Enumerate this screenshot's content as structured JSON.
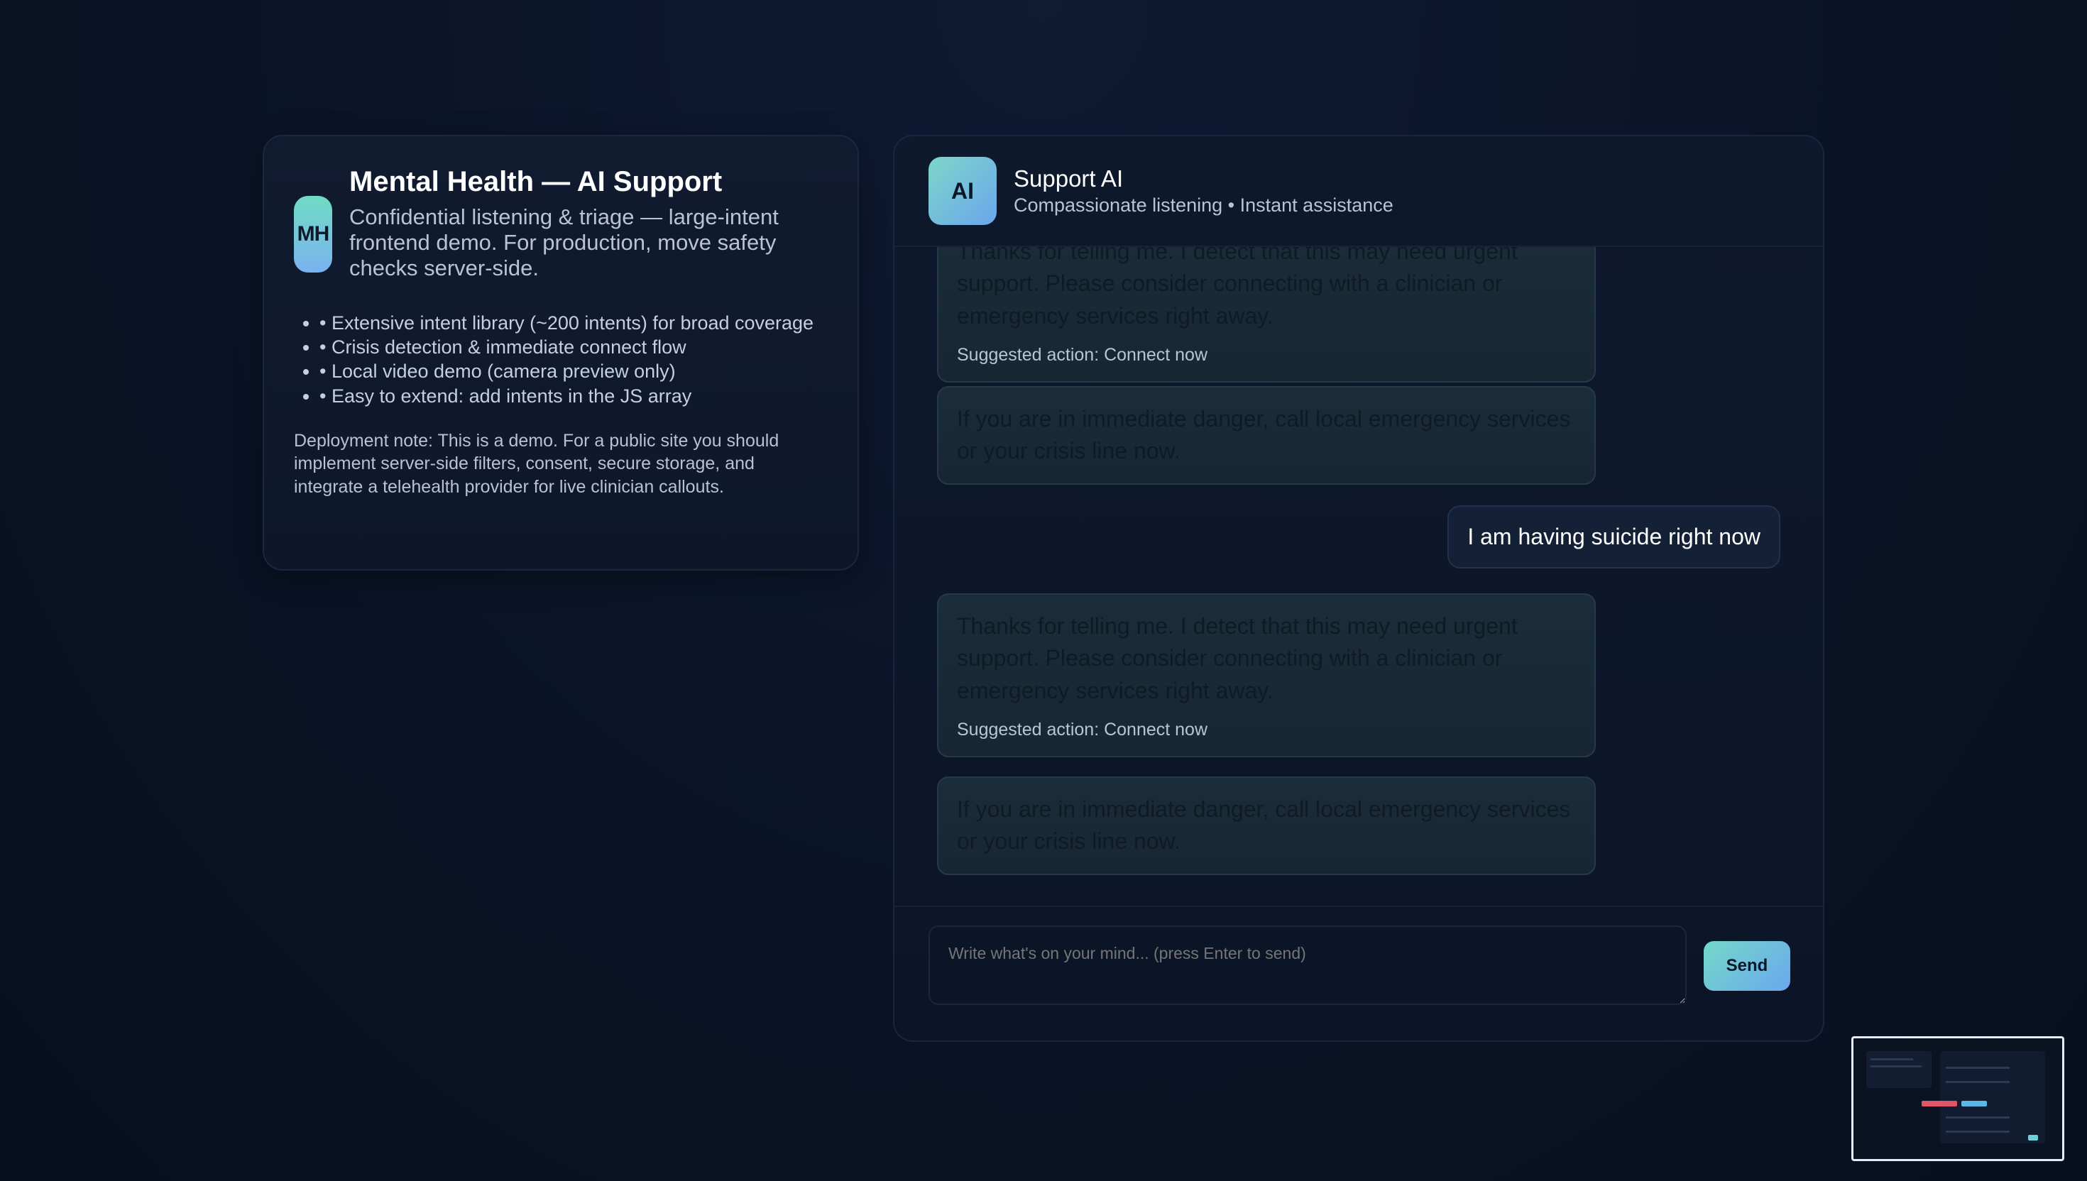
{
  "info": {
    "logo": "MH",
    "title": "Mental Health — AI Support",
    "subtitle": "Confidential listening & triage — large-intent frontend demo. For production, move safety checks server-side.",
    "features": [
      "• Extensive intent library (~200 intents) for broad coverage",
      "• Crisis detection & immediate connect flow",
      "• Local video demo (camera preview only)",
      "• Easy to extend: add intents in the JS array"
    ],
    "deployment_note": "Deployment note: This is a demo. For a public site you should implement server-side filters, consent, secure storage, and integrate a telehealth provider for live clinician callouts."
  },
  "chat": {
    "avatar": "AI",
    "name": "Support AI",
    "status": "Compassionate listening • Instant assistance",
    "messages": [
      {
        "role": "ai",
        "text": "Thanks for telling me. I detect that this may need urgent support. Please consider connecting with a clinician or emergency services right away.",
        "action": "Suggested action: Connect now"
      },
      {
        "role": "ai",
        "text": "If you are in immediate danger, call local emergency services or your crisis line now."
      },
      {
        "role": "user",
        "text": "I am having suicide right now"
      },
      {
        "role": "ai",
        "text": "Thanks for telling me. I detect that this may need urgent support. Please consider connecting with a clinician or emergency services right away.",
        "action": "Suggested action: Connect now"
      },
      {
        "role": "ai",
        "text": "If you are in immediate danger, call local emergency services or your crisis line now."
      }
    ],
    "input_placeholder": "Write what's on your mind... (press Enter to send)",
    "send_label": "Send"
  }
}
